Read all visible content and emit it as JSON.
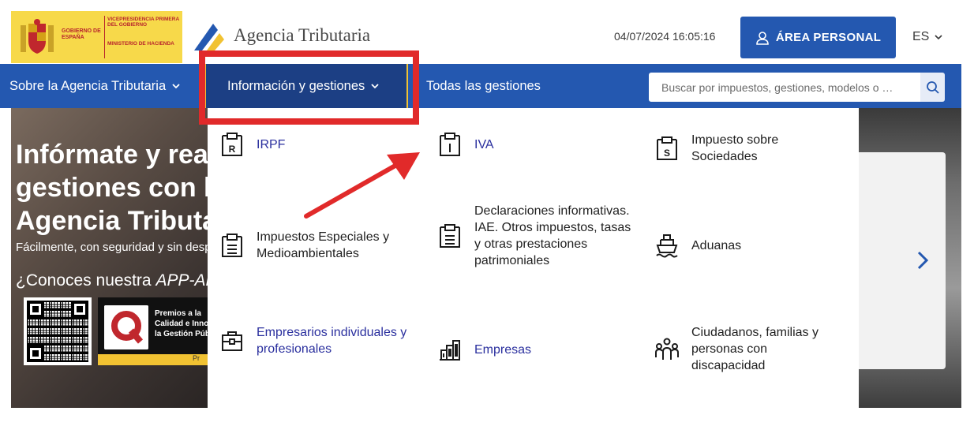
{
  "header": {
    "gov_logo": {
      "line1": "GOBIERNO DE ESPAÑA",
      "line2": "VICEPRESIDENCIA PRIMERA DEL GOBIERNO",
      "line3": "MINISTERIO DE HACIENDA"
    },
    "brand": "Agencia Tributaria",
    "datetime": "04/07/2024 16:05:16",
    "area_button": "ÁREA PERSONAL",
    "language": "ES"
  },
  "nav": {
    "items": [
      {
        "label": "Sobre la Agencia Tributaria"
      },
      {
        "label": "Información y gestiones"
      },
      {
        "label": "Todas las gestiones"
      }
    ],
    "search_placeholder": "Buscar por impuestos, gestiones, modelos o …"
  },
  "hero": {
    "title": "Infórmate y realiza gestiones con la Agencia Tributaria",
    "subtitle": "Fácilmente, con seguridad y sin desplazamientos",
    "app_prefix": "¿Conoces nuestra ",
    "app_name": "APP-AEAT?",
    "award_line1": "Premios a la",
    "award_line2": "Calidad e Innovación",
    "award_line3": "la Gestión Pública",
    "award_bar": "Pr"
  },
  "menu": {
    "items": [
      {
        "label": "IRPF",
        "icon": "irpf-icon",
        "link": true
      },
      {
        "label": "IVA",
        "icon": "iva-icon",
        "link": true
      },
      {
        "label": "Impuesto sobre Sociedades",
        "icon": "sociedades-icon",
        "link": false
      },
      {
        "label": "Impuestos Especiales y Medioambientales",
        "icon": "document-icon",
        "link": false
      },
      {
        "label": "Declaraciones informativas. IAE. Otros impuestos, tasas y otras prestaciones patrimoniales",
        "icon": "document-icon",
        "link": false
      },
      {
        "label": "Aduanas",
        "icon": "ship-icon",
        "link": false
      },
      {
        "label": "Empresarios individuales y profesionales",
        "icon": "briefcase-icon",
        "link": true
      },
      {
        "label": "Empresas",
        "icon": "buildings-icon",
        "link": true
      },
      {
        "label": "Ciudadanos, familias y personas con discapacidad",
        "icon": "people-icon",
        "link": false
      }
    ]
  },
  "colors": {
    "primary": "#2458b0",
    "nav_active": "#1c3f84",
    "accent": "#f1c232",
    "link": "#2a2f9e",
    "annotation": "#e12a2a"
  }
}
